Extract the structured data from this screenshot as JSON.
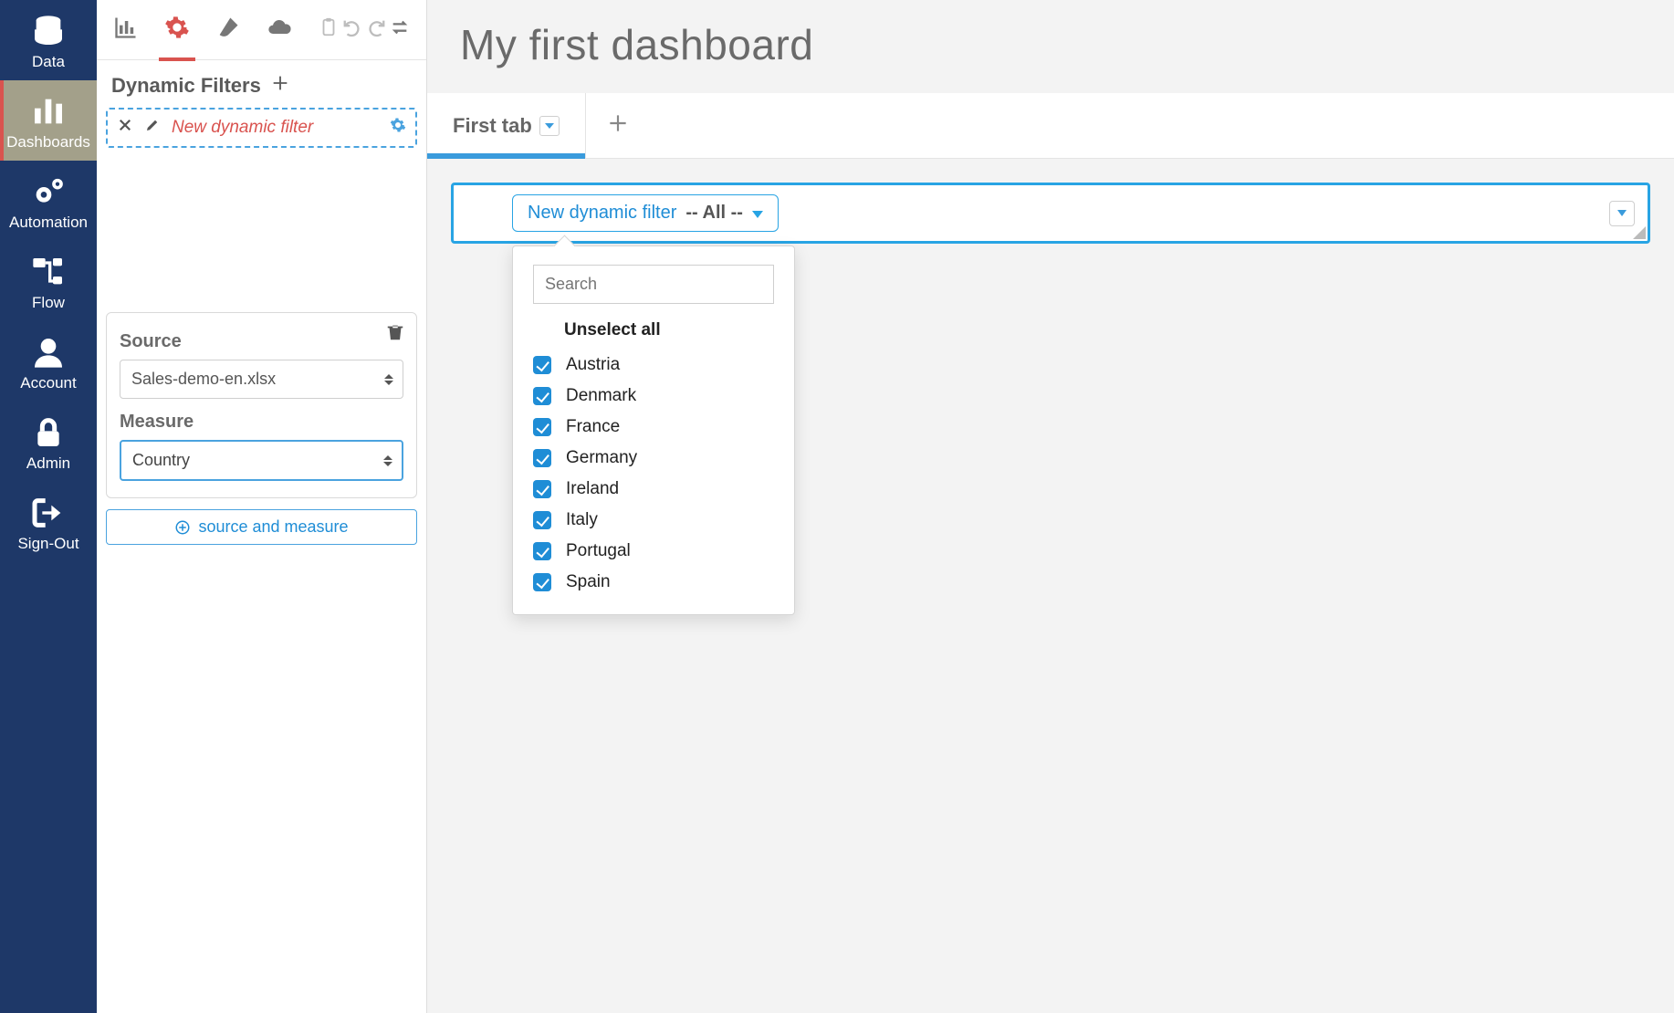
{
  "nav": {
    "items": [
      {
        "label": "Data"
      },
      {
        "label": "Dashboards"
      },
      {
        "label": "Automation"
      },
      {
        "label": "Flow"
      },
      {
        "label": "Account"
      },
      {
        "label": "Admin"
      },
      {
        "label": "Sign-Out"
      }
    ]
  },
  "panel": {
    "filters_title": "Dynamic Filters",
    "filter_name": "New dynamic filter",
    "source_label": "Source",
    "source_value": "Sales-demo-en.xlsx",
    "measure_label": "Measure",
    "measure_value": "Country",
    "add_source_label": "source and measure"
  },
  "main": {
    "title": "My first dashboard",
    "tab_label": "First tab",
    "filter_pill_label": "New dynamic filter",
    "filter_pill_value": "-- All --",
    "popover": {
      "search_placeholder": "Search",
      "unselect_label": "Unselect all",
      "options": [
        "Austria",
        "Denmark",
        "France",
        "Germany",
        "Ireland",
        "Italy",
        "Portugal",
        "Spain"
      ]
    }
  }
}
